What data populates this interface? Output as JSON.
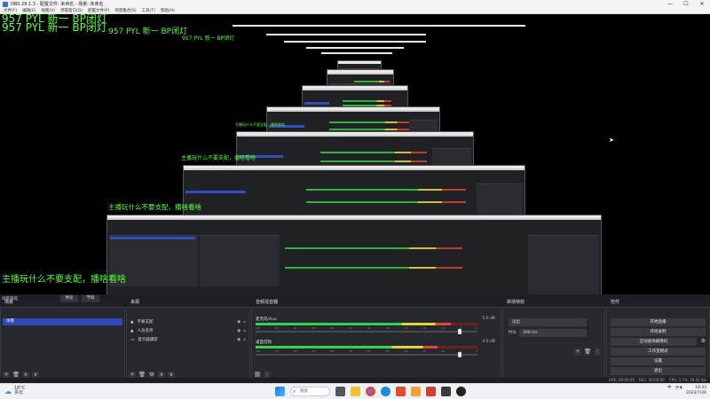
{
  "window": {
    "title": "OBS 29.1.3 - 配置文件: 未命名 - 场景: 未命名",
    "controls": [
      "—",
      "☐",
      "✕"
    ]
  },
  "menu": [
    "文件(F)",
    "编辑(E)",
    "视图(V)",
    "停靠窗口(D)",
    "配置文件(P)",
    "场景集合(S)",
    "工具(T)",
    "帮助(H)"
  ],
  "overlay": {
    "line1": "957 PYL 新一 BP闭灯",
    "line2": "957 PYL 新一 BP闭灯",
    "streamer_text": "主播玩什么不要支配，播啥看啥"
  },
  "scenes": {
    "header": "场景",
    "items": [
      "场景"
    ]
  },
  "sources": {
    "header": "来源",
    "items": [
      {
        "name": "不要支配",
        "icon": "image-icon"
      },
      {
        "name": "人员名单",
        "icon": "image-icon"
      },
      {
        "name": "显示器捕获",
        "icon": "monitor-icon"
      }
    ]
  },
  "mixer": {
    "header": "音频混音器",
    "channels": [
      {
        "name": "桌面音频",
        "db": "0.0 dB",
        "level": 0.82,
        "fader": 0.92
      },
      {
        "name": "麦克风/Aux",
        "db": "0.0 dB",
        "level": 0.88,
        "fader": 0.92
      }
    ],
    "scale": [
      "-60",
      "-55",
      "-50",
      "-45",
      "-40",
      "-35",
      "-30",
      "-25",
      "-20",
      "-15",
      "-10",
      "-5",
      "0"
    ]
  },
  "transitions": {
    "header": "转场特效",
    "type": "淡出",
    "duration_label": "时长",
    "duration": "300 ms"
  },
  "controls": {
    "header": "控件",
    "buttons": [
      "开始直播",
      "开始录制",
      "启动虚拟摄像机",
      "工作室模式",
      "设置",
      "退出"
    ]
  },
  "scene_filter": {
    "studio_btn_a": "预览",
    "studio_btn_b": "节目"
  },
  "status": {
    "live": "LIVE: 00:00:00",
    "rec": "REC: 00:00:00",
    "cpu": "CPU: 3.7%, 59.02 fps"
  },
  "taskbar": {
    "weather_temp": "18°C",
    "weather_desc": "多云",
    "search_placeholder": "搜索",
    "time": "19:33",
    "date": "2023/7/26",
    "lang": "中"
  },
  "colors": {
    "overlay_green": "#5cff3a",
    "selection_blue": "#2b49b8",
    "panel_bg": "#27282d"
  }
}
